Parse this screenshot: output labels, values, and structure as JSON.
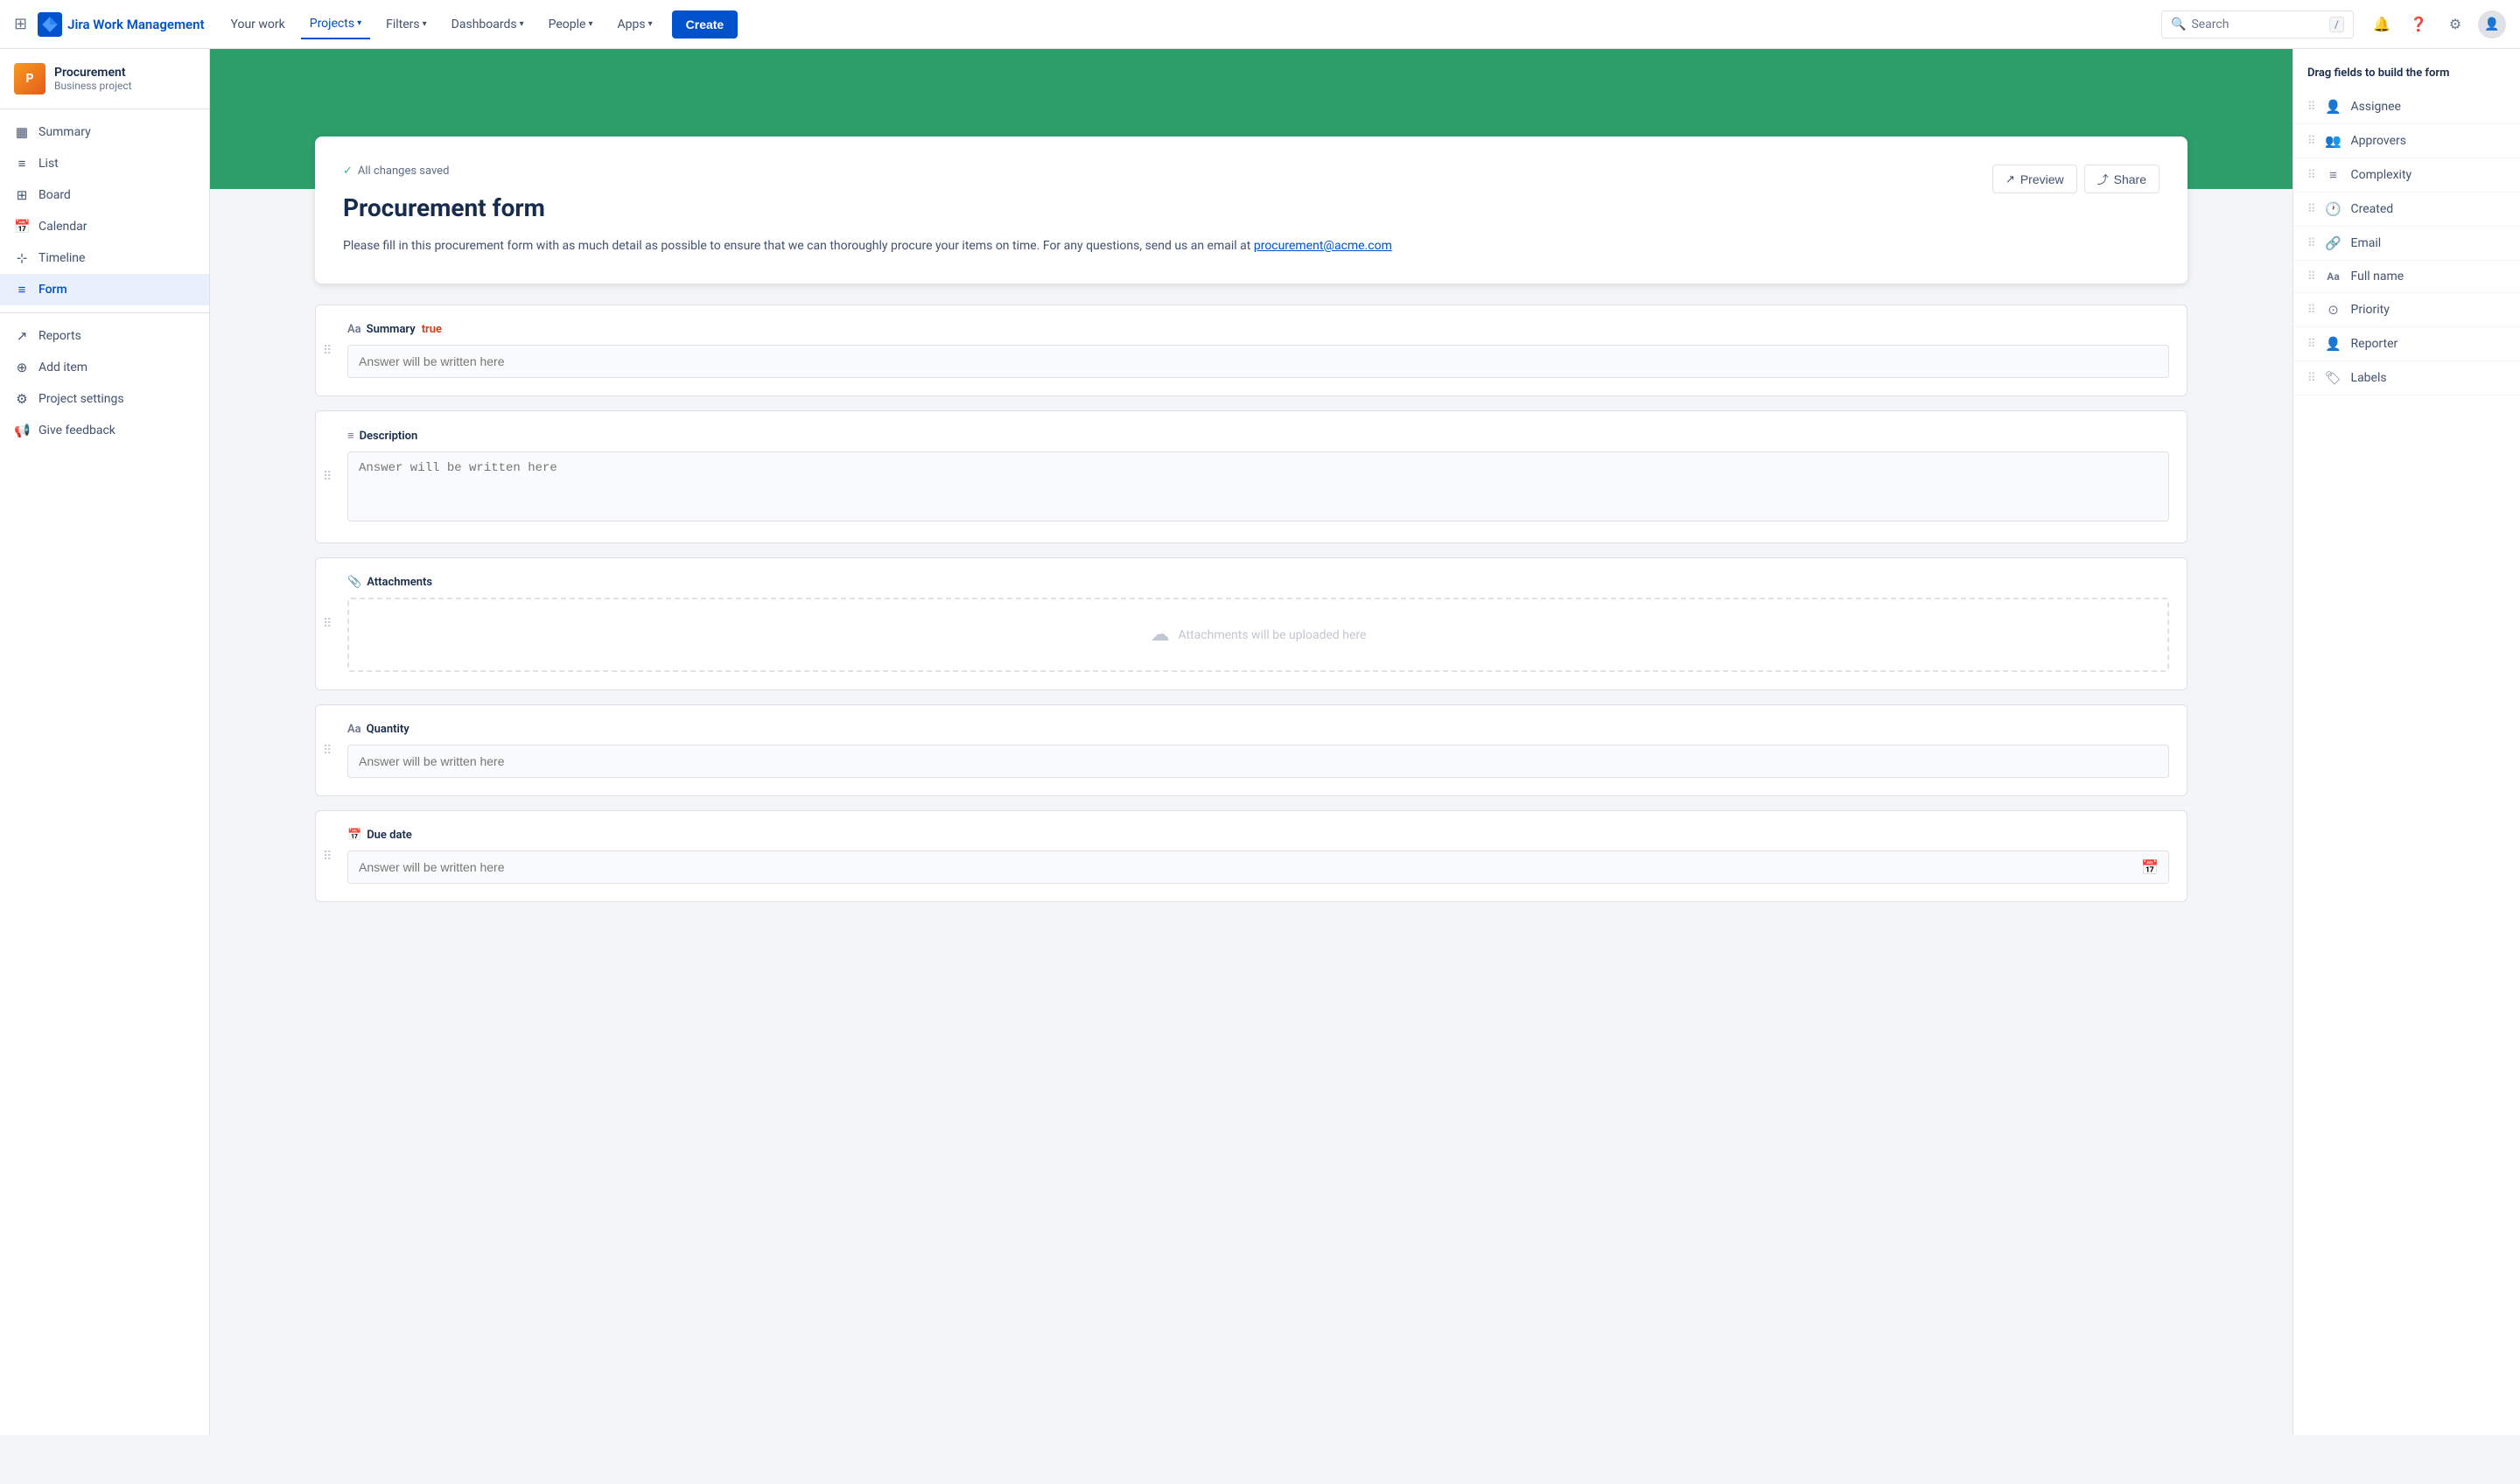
{
  "topnav": {
    "app_name": "Jira Work Management",
    "links": [
      {
        "label": "Your work",
        "active": false
      },
      {
        "label": "Projects",
        "active": true
      },
      {
        "label": "Filters",
        "active": false
      },
      {
        "label": "Dashboards",
        "active": false
      },
      {
        "label": "People",
        "active": false
      },
      {
        "label": "Apps",
        "active": false
      }
    ],
    "create_label": "Create",
    "search_placeholder": "Search",
    "search_key": "/"
  },
  "sidebar": {
    "project_name": "Procurement",
    "project_type": "Business project",
    "nav_items": [
      {
        "label": "Summary",
        "icon": "▦",
        "active": false
      },
      {
        "label": "List",
        "icon": "≡",
        "active": false
      },
      {
        "label": "Board",
        "icon": "⊞",
        "active": false
      },
      {
        "label": "Calendar",
        "icon": "📅",
        "active": false
      },
      {
        "label": "Timeline",
        "icon": "⊹",
        "active": false
      },
      {
        "label": "Form",
        "icon": "≡",
        "active": true
      },
      {
        "label": "Reports",
        "icon": "↗",
        "active": false
      },
      {
        "label": "Add item",
        "icon": "⊕",
        "active": false
      },
      {
        "label": "Project settings",
        "icon": "⚙",
        "active": false
      },
      {
        "label": "Give feedback",
        "icon": "📢",
        "active": false
      }
    ]
  },
  "form": {
    "status": "All changes saved",
    "preview_label": "Preview",
    "share_label": "Share",
    "title": "Procurement form",
    "description": "Please fill in this procurement form with as much detail as possible to ensure that we can thoroughly procure your items on time. For any questions, send us an email at",
    "email_link": "procurement@acme.com",
    "fields": [
      {
        "id": "summary",
        "label": "Summary",
        "required": true,
        "type": "input",
        "icon": "Aa",
        "placeholder": "Answer will be written here"
      },
      {
        "id": "description",
        "label": "Description",
        "required": false,
        "type": "textarea",
        "icon": "≡",
        "placeholder": "Answer will be written here"
      },
      {
        "id": "attachments",
        "label": "Attachments",
        "required": false,
        "type": "upload",
        "icon": "📎",
        "placeholder": "Attachments will be uploaded here"
      },
      {
        "id": "quantity",
        "label": "Quantity",
        "required": false,
        "type": "input",
        "icon": "Aa",
        "placeholder": "Answer will be written here"
      },
      {
        "id": "due_date",
        "label": "Due date",
        "required": false,
        "type": "date",
        "icon": "📅",
        "placeholder": "Answer will be written here"
      }
    ]
  },
  "right_panel": {
    "title": "Drag fields to build the form",
    "items": [
      {
        "label": "Assignee",
        "icon": "👤"
      },
      {
        "label": "Approvers",
        "icon": "👥"
      },
      {
        "label": "Complexity",
        "icon": "≡"
      },
      {
        "label": "Created",
        "icon": "🕐"
      },
      {
        "label": "Email",
        "icon": "🔗"
      },
      {
        "label": "Full name",
        "icon": "Aa"
      },
      {
        "label": "Priority",
        "icon": "⊙"
      },
      {
        "label": "Reporter",
        "icon": "👤"
      },
      {
        "label": "Labels",
        "icon": "🏷"
      }
    ]
  }
}
